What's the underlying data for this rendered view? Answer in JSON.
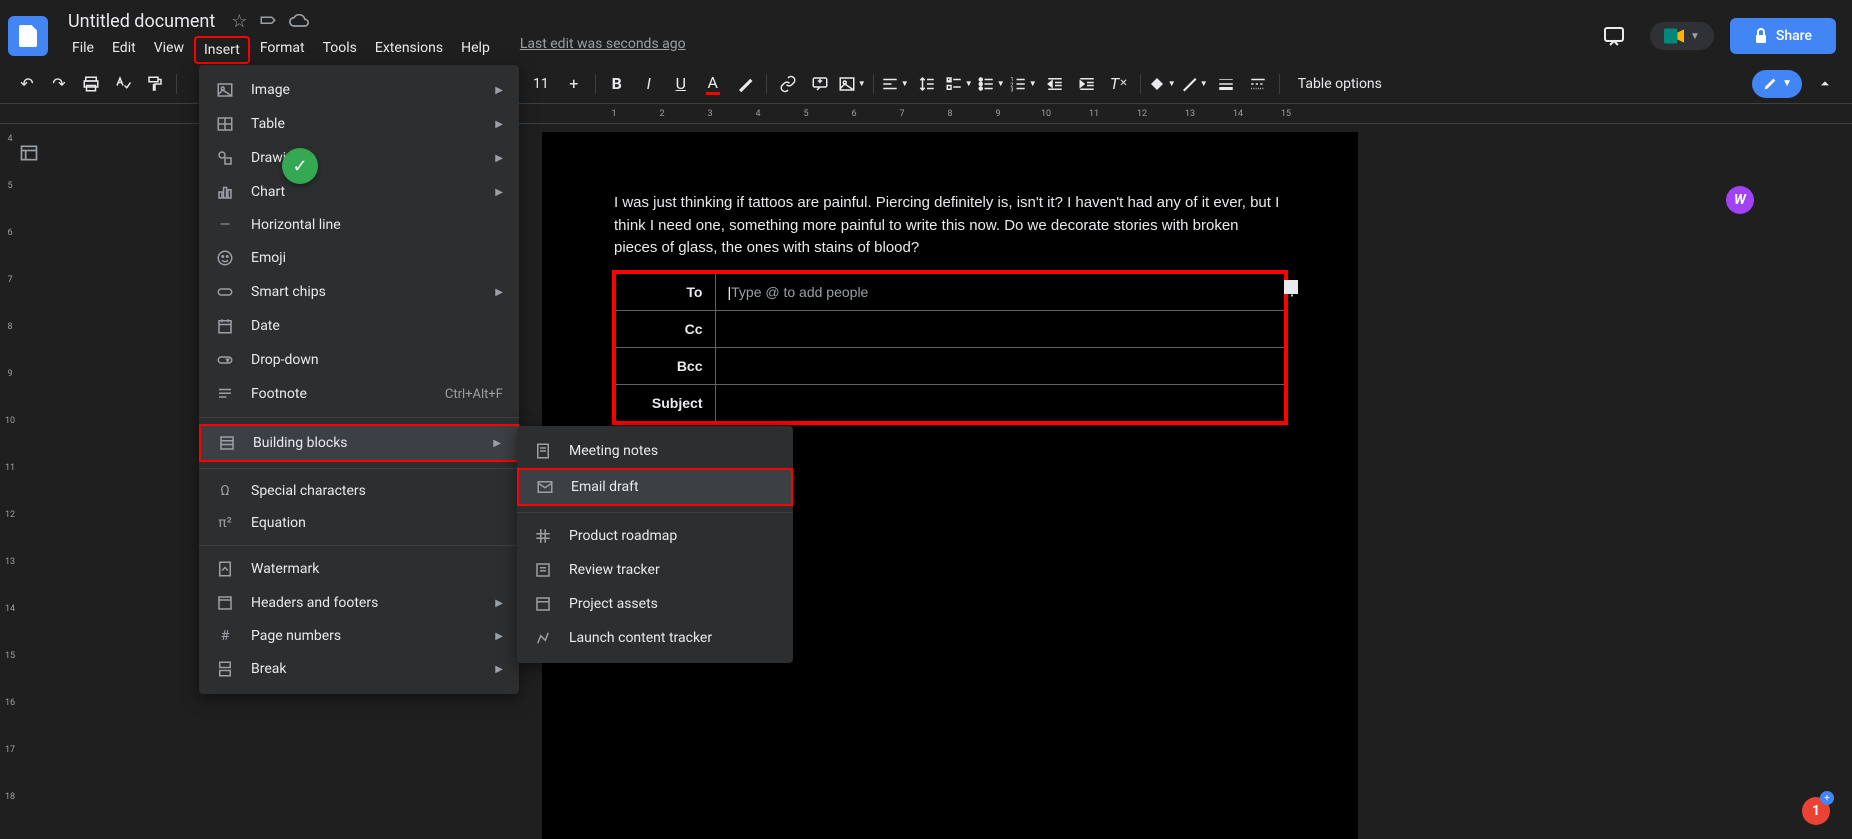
{
  "doc": {
    "title": "Untitled document",
    "lastEdit": "Last edit was seconds ago",
    "text": "I was just thinking if tattoos are painful. Piercing definitely is, isn't it? I haven't had any of it ever, but I think I need one, something more painful to write this now. Do we decorate stories with broken pieces of glass, the ones with stains of blood?"
  },
  "menuBar": [
    "File",
    "Edit",
    "View",
    "Insert",
    "Format",
    "Tools",
    "Extensions",
    "Help"
  ],
  "share": "Share",
  "tableOptions": "Table options",
  "fontSize": "11",
  "insertMenu": {
    "group1": [
      {
        "label": "Image",
        "sub": true,
        "icon": "image"
      },
      {
        "label": "Table",
        "sub": true,
        "icon": "table"
      },
      {
        "label": "Drawing",
        "sub": true,
        "icon": "drawing"
      },
      {
        "label": "Chart",
        "sub": true,
        "icon": "chart"
      },
      {
        "label": "Horizontal line",
        "sub": false,
        "icon": "hline"
      },
      {
        "label": "Emoji",
        "sub": false,
        "icon": "emoji"
      },
      {
        "label": "Smart chips",
        "sub": true,
        "icon": "chips"
      },
      {
        "label": "Date",
        "sub": false,
        "icon": "date"
      },
      {
        "label": "Drop-down",
        "sub": false,
        "icon": "dropdown"
      },
      {
        "label": "Footnote",
        "sub": false,
        "icon": "footnote",
        "shortcut": "Ctrl+Alt+F"
      }
    ],
    "group2": [
      {
        "label": "Building blocks",
        "sub": true,
        "icon": "blocks"
      }
    ],
    "group3": [
      {
        "label": "Special characters",
        "sub": false,
        "icon": "omega"
      },
      {
        "label": "Equation",
        "sub": false,
        "icon": "equation"
      }
    ],
    "group4": [
      {
        "label": "Watermark",
        "sub": false,
        "icon": "watermark"
      },
      {
        "label": "Headers and footers",
        "sub": true,
        "icon": "headers"
      },
      {
        "label": "Page numbers",
        "sub": true,
        "icon": "pagenum"
      },
      {
        "label": "Break",
        "sub": true,
        "icon": "break"
      }
    ]
  },
  "submenu": {
    "g1": [
      {
        "label": "Meeting notes",
        "icon": "note"
      },
      {
        "label": "Email draft",
        "icon": "email"
      }
    ],
    "g2": [
      {
        "label": "Product roadmap",
        "icon": "roadmap"
      },
      {
        "label": "Review tracker",
        "icon": "review"
      },
      {
        "label": "Project assets",
        "icon": "assets"
      },
      {
        "label": "Launch content tracker",
        "icon": "launch"
      }
    ]
  },
  "emailDraft": {
    "labels": [
      "To",
      "Cc",
      "Bcc",
      "Subject"
    ],
    "toPlaceholder": "Type @ to add people"
  },
  "ruler": {
    "h": [
      "1",
      "2",
      "3",
      "4",
      "5",
      "6",
      "7",
      "8",
      "9",
      "10",
      "11",
      "12",
      "13",
      "14",
      "15"
    ],
    "v": [
      "4",
      "5",
      "6",
      "7",
      "8",
      "9",
      "10",
      "11",
      "12",
      "13",
      "14",
      "15",
      "16",
      "17",
      "18"
    ]
  },
  "avatar": "W",
  "notif": "1"
}
